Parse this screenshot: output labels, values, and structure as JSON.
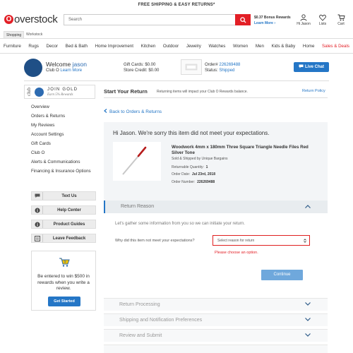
{
  "promo_bar": "FREE SHIPPING & EASY RETURNS*",
  "header": {
    "logo_text": "overstock",
    "search_placeholder": "Search",
    "rewards_line1": "$0.37 Bonus Rewards",
    "rewards_line2": "Learn More ›",
    "account_label": "Hi Jason",
    "lists_label": "Lists",
    "cart_label": "Cart",
    "cart_count": "0"
  },
  "tabs": [
    "Shopping",
    "Workstock"
  ],
  "categories": [
    "Furniture",
    "Rugs",
    "Decor",
    "Bed & Bath",
    "Home Improvement",
    "Kitchen",
    "Outdoor",
    "Jewelry",
    "Watches",
    "Women",
    "Men",
    "Kids & Baby",
    "Home",
    "Sales & Deals"
  ],
  "account": {
    "welcome": "Welcome",
    "name": "jason",
    "club_label": "Club O",
    "learn_more": "Learn More",
    "gift_cards": "Gift Cards:  $0.00",
    "store_credit": "Store Credit: $0.00",
    "order_label": "Order#",
    "order_number": "226269488",
    "status_label": "Status:",
    "status_value": "Shipped",
    "live_chat": "Live Chat"
  },
  "sidebar": {
    "club_vertical": "club",
    "join_gold": "JOIN GOLD",
    "earn": "Earn 5% Rewards",
    "nav": [
      "Overview",
      "Orders & Returns",
      "My Reviews",
      "Account Settings",
      "Gift Cards",
      "Club O",
      "Alerts & Communications",
      "Financing & Insurance Options"
    ],
    "buttons": [
      "Text Us",
      "Help Center",
      "Product Guides",
      "Leave Feedback"
    ],
    "promo_text": "Be entered to win $500 in rewards when you write a review.",
    "promo_button": "Get Started"
  },
  "main": {
    "title": "Start Your Return",
    "subtitle": "Returning items will impact your Club O Rewards balance.",
    "return_policy": "Return Policy",
    "back_link": "Back to Orders & Returns",
    "greeting": "Hi Jason. We're sorry this item did not meet your expectations.",
    "product": {
      "name": "Woodwork 4mm x 180mm Three Square Triangle Needle Files Red Silver Tone",
      "sold_by": "Sold & Shipped by Unique Bargains",
      "qty_label": "Returnable Quantity:",
      "qty_value": "1",
      "date_label": "Order Date:",
      "date_value": "Jul 23rd, 2018",
      "num_label": "Order Number:",
      "num_value": "226269488"
    },
    "steps": {
      "reason": "Return Reason",
      "processing": "Return Processing",
      "shipping": "Shipping and Notification Preferences",
      "review": "Review and Submit"
    },
    "gather": "Let's gather some information from you so we can initiate your return.",
    "why_label": "Why did this item not meet your expectations?",
    "select_placeholder": "Select reason for return",
    "error": "Please choose an option.",
    "continue": "Continue"
  }
}
